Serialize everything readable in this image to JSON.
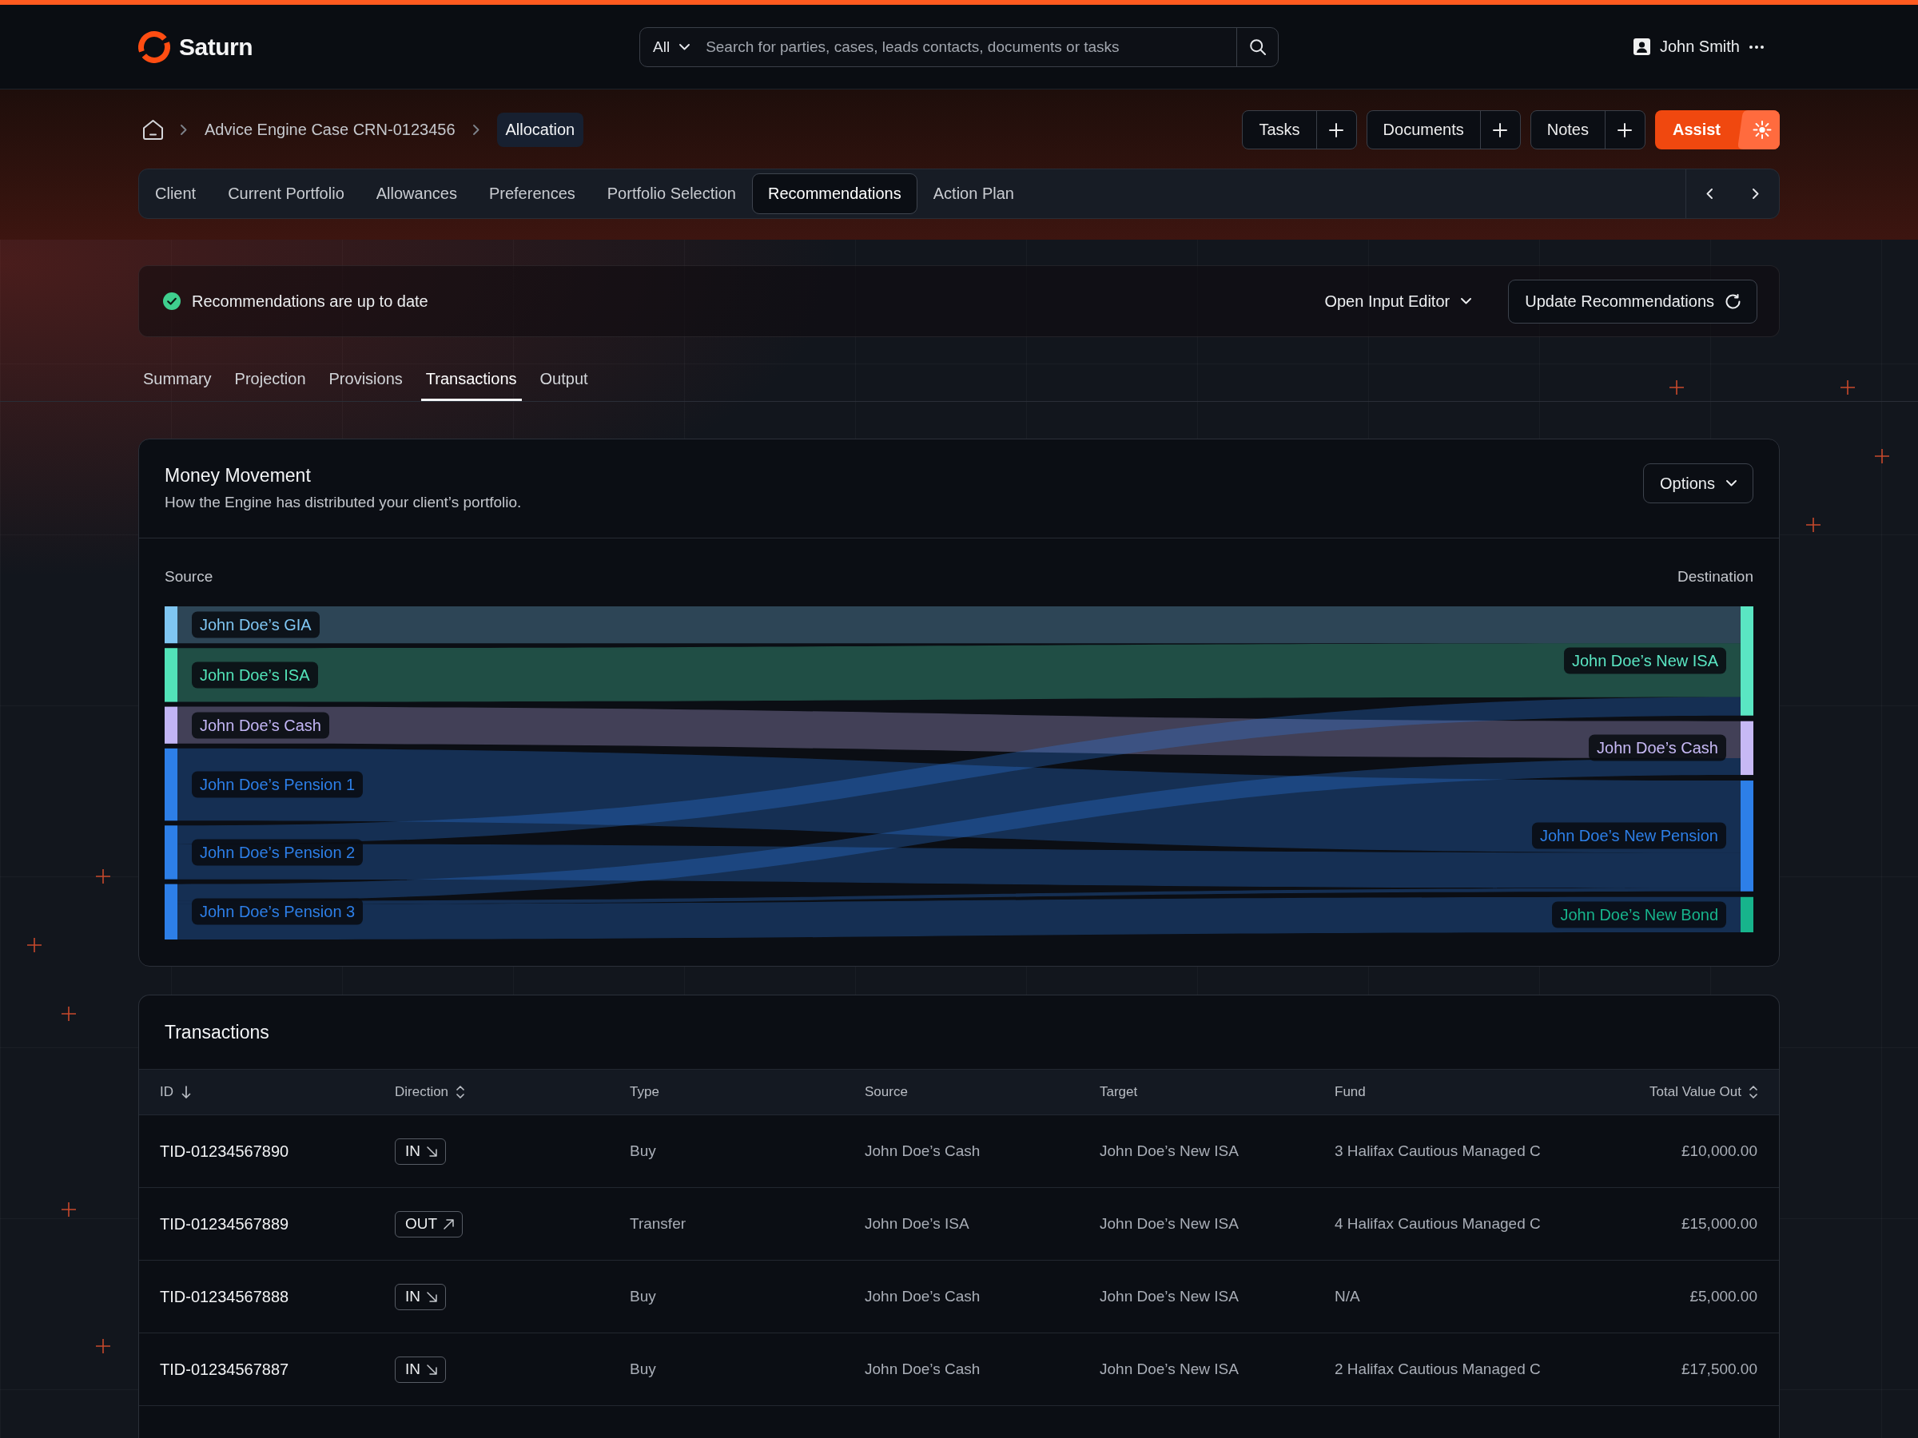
{
  "header": {
    "logo": "Saturn",
    "search": {
      "scope": "All",
      "placeholder": "Search for parties, cases, leads contacts, documents or tasks"
    },
    "user_name": "John Smith"
  },
  "breadcrumb": [
    {
      "label": "Advice Engine Case CRN-0123456",
      "selected": false
    },
    {
      "label": "Allocation",
      "selected": true
    }
  ],
  "actions": [
    {
      "label": "Tasks",
      "kind": "split"
    },
    {
      "label": "Documents",
      "kind": "split"
    },
    {
      "label": "Notes",
      "kind": "split"
    },
    {
      "label": "Assist",
      "kind": "primary"
    }
  ],
  "tabs": [
    {
      "label": "Client",
      "selected": false
    },
    {
      "label": "Current Portfolio",
      "selected": false
    },
    {
      "label": "Allowances",
      "selected": false
    },
    {
      "label": "Preferences",
      "selected": false
    },
    {
      "label": "Portfolio Selection",
      "selected": false
    },
    {
      "label": "Recommendations",
      "selected": true
    },
    {
      "label": "Action Plan",
      "selected": false
    }
  ],
  "status": {
    "message": "Recommendations are up to date",
    "editor_menu": "Open Input Editor",
    "update_button": "Update Recommendations"
  },
  "sub_tabs": [
    {
      "label": "Summary",
      "selected": false
    },
    {
      "label": "Projection",
      "selected": false
    },
    {
      "label": "Provisions",
      "selected": false
    },
    {
      "label": "Transactions",
      "selected": true
    },
    {
      "label": "Output",
      "selected": false
    }
  ],
  "money_movement": {
    "title": "Money Movement",
    "subtitle": "How the Engine has distributed your client’s portfolio.",
    "options_button": "Options",
    "source_heading": "Source",
    "destination_heading": "Destination",
    "sources": [
      {
        "label": "John Doe’s GIA",
        "color": "#7fc6f2"
      },
      {
        "label": "John Doe’s ISA",
        "color": "#52e3b8"
      },
      {
        "label": "John Doe’s Cash",
        "color": "#c2b5f5"
      },
      {
        "label": "John Doe’s Pension 1",
        "color": "#2d7fe8"
      },
      {
        "label": "John Doe’s Pension 2",
        "color": "#2d7fe8"
      },
      {
        "label": "John Doe’s Pension 3",
        "color": "#2d7fe8"
      }
    ],
    "destinations": [
      {
        "label": "John Doe’s New ISA",
        "color": "#5ae6c3"
      },
      {
        "label": "John Doe’s Cash",
        "color": "#c7b9f5"
      },
      {
        "label": "John Doe’s New Pension",
        "color": "#2d7fe8"
      },
      {
        "label": "John Doe’s New Bond",
        "color": "#17b48c"
      }
    ]
  },
  "transactions": {
    "title": "Transactions",
    "columns": [
      {
        "label": "ID",
        "kind": "id",
        "sorted": true
      },
      {
        "label": "Direction",
        "kind": "direction",
        "sorted": false
      },
      {
        "label": "Type",
        "kind": "text"
      },
      {
        "label": "Source",
        "kind": "text"
      },
      {
        "label": "Target",
        "kind": "text"
      },
      {
        "label": "Fund",
        "kind": "text"
      },
      {
        "label": "Total Value Out",
        "kind": "amount",
        "sorted": false
      }
    ],
    "rows": [
      {
        "id": "TID-01234567890",
        "direction": {
          "label": "IN",
          "kind": "in"
        },
        "type": "Buy",
        "source": "John Doe’s Cash",
        "target": "John Doe’s New ISA",
        "fund": "3 Halifax Cautious Managed C",
        "total_value_out": "£10,000.00"
      },
      {
        "id": "TID-01234567889",
        "direction": {
          "label": "OUT",
          "kind": "out"
        },
        "type": "Transfer",
        "source": "John Doe’s ISA",
        "target": "John Doe’s New ISA",
        "fund": "4 Halifax Cautious Managed C",
        "total_value_out": "£15,000.00"
      },
      {
        "id": "TID-01234567888",
        "direction": {
          "label": "IN",
          "kind": "in"
        },
        "type": "Buy",
        "source": "John Doe’s Cash",
        "target": "John Doe’s New ISA",
        "fund": "N/A",
        "total_value_out": "£5,000.00"
      },
      {
        "id": "TID-01234567887",
        "direction": {
          "label": "IN",
          "kind": "in"
        },
        "type": "Buy",
        "source": "John Doe’s Cash",
        "target": "John Doe’s New ISA",
        "fund": "2 Halifax Cautious Managed C",
        "total_value_out": "£17,500.00"
      }
    ]
  }
}
